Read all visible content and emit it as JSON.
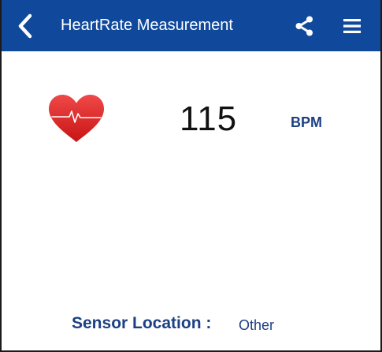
{
  "app_bar": {
    "title": "HeartRate Measurement",
    "background_color": "#10499c",
    "back_icon": "chevron-left-icon",
    "share_icon": "share-icon",
    "menu_icon": "hamburger-menu-icon"
  },
  "measurement": {
    "icon": "heart-pulse-icon",
    "value": "115",
    "unit": "BPM"
  },
  "sensor": {
    "label": "Sensor Location :",
    "value": "Other"
  },
  "colors": {
    "accent": "#1d3f84",
    "heart": "#e02a2a"
  }
}
